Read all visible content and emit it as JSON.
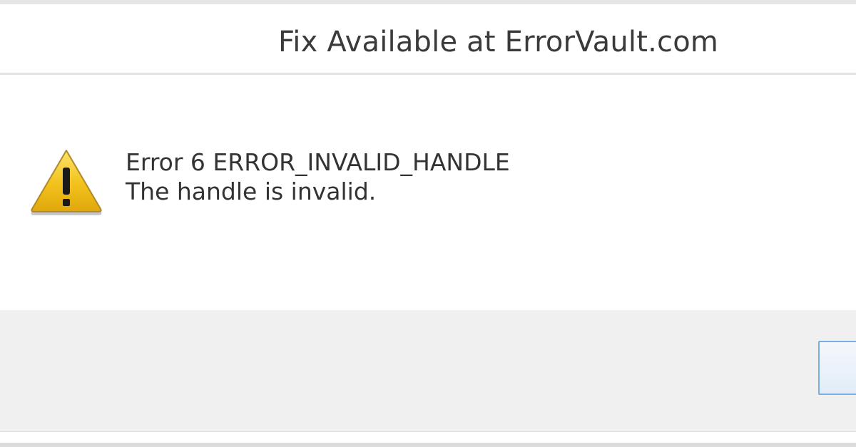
{
  "dialog": {
    "title": "Fix Available at ErrorVault.com",
    "error_line": "Error 6 ERROR_INVALID_HANDLE",
    "description": "The handle is invalid.",
    "icon": "warning-icon",
    "ok_button_label": ""
  },
  "colors": {
    "warning_yellow": "#f2c21b",
    "button_border": "#7aaee0",
    "footer_background": "#f0f0f0"
  }
}
